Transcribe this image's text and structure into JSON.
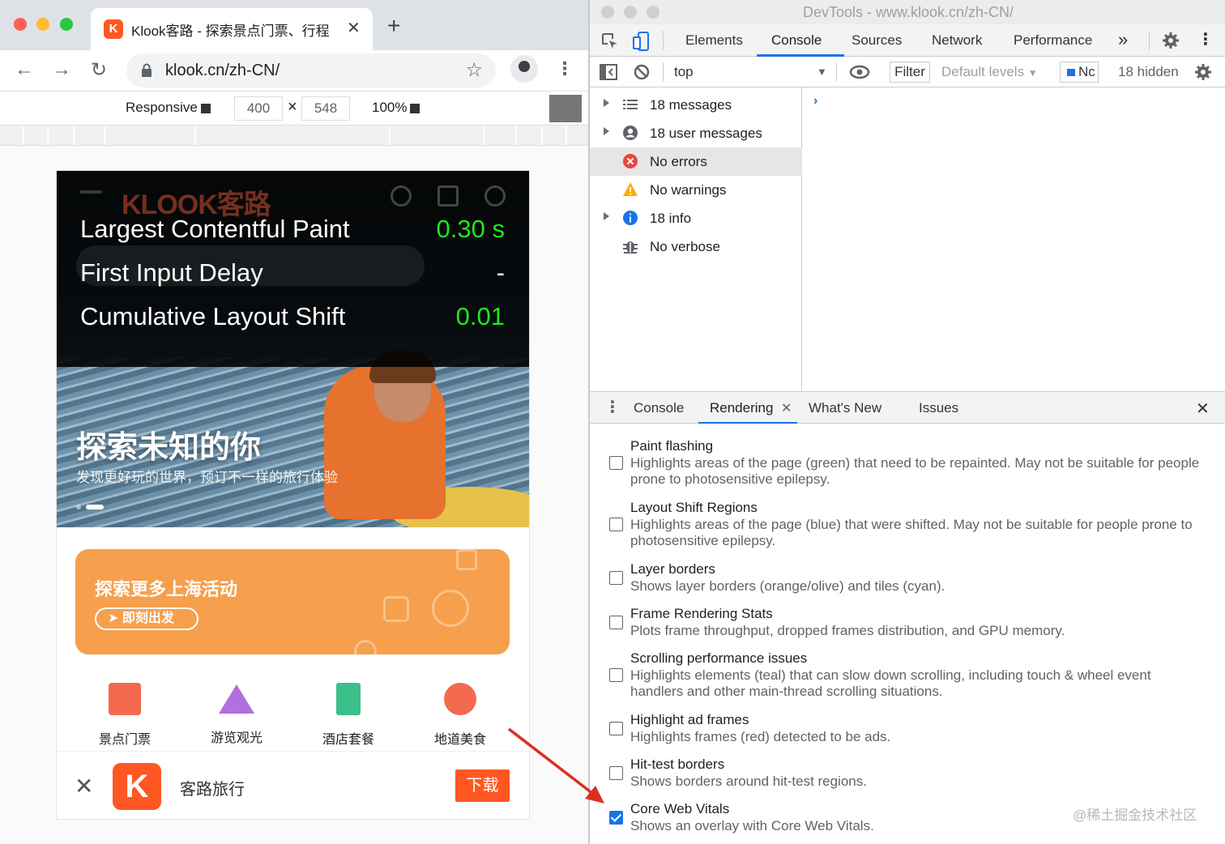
{
  "browser": {
    "tab_title": "Klook客路 - 探索景点门票、行程",
    "favicon_letter": "K",
    "url": "klook.cn/zh-CN/",
    "device_toolbar": {
      "mode": "Responsive",
      "width": "400",
      "times": "×",
      "height": "548",
      "zoom": "100%"
    }
  },
  "page": {
    "brand": "KLOOK客路",
    "vitals": [
      {
        "label": "Largest Contentful Paint",
        "value": "0.30 s"
      },
      {
        "label": "First Input Delay",
        "value": "-"
      },
      {
        "label": "Cumulative Layout Shift",
        "value": "0.01"
      }
    ],
    "hero_title": "探索未知的你",
    "hero_subtitle": "发现更好玩的世界，预订不一样的旅行体验",
    "banner_title": "探索更多上海活动",
    "banner_button": "即刻出发",
    "categories": [
      {
        "label": "景点门票",
        "icon": "ticket-icon",
        "color": "#f46a4e"
      },
      {
        "label": "游览观光",
        "icon": "mountain-icon",
        "color": "#b26fe0"
      },
      {
        "label": "酒店套餐",
        "icon": "hotel-icon",
        "color": "#3cbf8a"
      },
      {
        "label": "地道美食",
        "icon": "food-icon",
        "color": "#f46a4e"
      }
    ],
    "app_banner": {
      "close": "✕",
      "logo": "K",
      "name": "客路旅行",
      "download": "下载"
    }
  },
  "devtools": {
    "title": "DevTools - www.klook.cn/zh-CN/",
    "tabs": [
      "Elements",
      "Console",
      "Sources",
      "Network",
      "Performance"
    ],
    "active_tab": "Console",
    "more_tabs": "»",
    "console_toolbar": {
      "context": "top",
      "filter": "Filter",
      "levels": "Default levels",
      "badge": "Nc",
      "hidden": "18 hidden"
    },
    "sidebar": [
      {
        "label": "18 messages",
        "icon": "list-icon",
        "expandable": true
      },
      {
        "label": "18 user messages",
        "icon": "user-icon",
        "expandable": true
      },
      {
        "label": "No errors",
        "icon": "error-icon",
        "expandable": false,
        "selected": true
      },
      {
        "label": "No warnings",
        "icon": "warning-icon",
        "expandable": false
      },
      {
        "label": "18 info",
        "icon": "info-icon",
        "expandable": true
      },
      {
        "label": "No verbose",
        "icon": "bug-icon",
        "expandable": false
      }
    ],
    "prompt": "›",
    "drawer_tabs": [
      "Console",
      "Rendering",
      "What's New",
      "Issues"
    ],
    "drawer_active": "Rendering",
    "rendering_options": [
      {
        "title": "Paint flashing",
        "desc": "Highlights areas of the page (green) that need to be repainted. May not be suitable for people prone to photosensitive epilepsy.",
        "checked": false
      },
      {
        "title": "Layout Shift Regions",
        "desc": "Highlights areas of the page (blue) that were shifted. May not be suitable for people prone to photosensitive epilepsy.",
        "checked": false
      },
      {
        "title": "Layer borders",
        "desc": "Shows layer borders (orange/olive) and tiles (cyan).",
        "checked": false
      },
      {
        "title": "Frame Rendering Stats",
        "desc": "Plots frame throughput, dropped frames distribution, and GPU memory.",
        "checked": false
      },
      {
        "title": "Scrolling performance issues",
        "desc": "Highlights elements (teal) that can slow down scrolling, including touch & wheel event handlers and other main-thread scrolling situations.",
        "checked": false
      },
      {
        "title": "Highlight ad frames",
        "desc": "Highlights frames (red) detected to be ads.",
        "checked": false
      },
      {
        "title": "Hit-test borders",
        "desc": "Shows borders around hit-test regions.",
        "checked": false
      },
      {
        "title": "Core Web Vitals",
        "desc": "Shows an overlay with Core Web Vitals.",
        "checked": true
      }
    ],
    "watermark": "@稀土掘金技术社区"
  },
  "colors": {
    "accent": "#1a73e8",
    "vital_good": "#1ee81e",
    "klook_orange": "#ff5722",
    "banner_orange": "#f6a04d",
    "annotation_arrow": "#d93025"
  }
}
